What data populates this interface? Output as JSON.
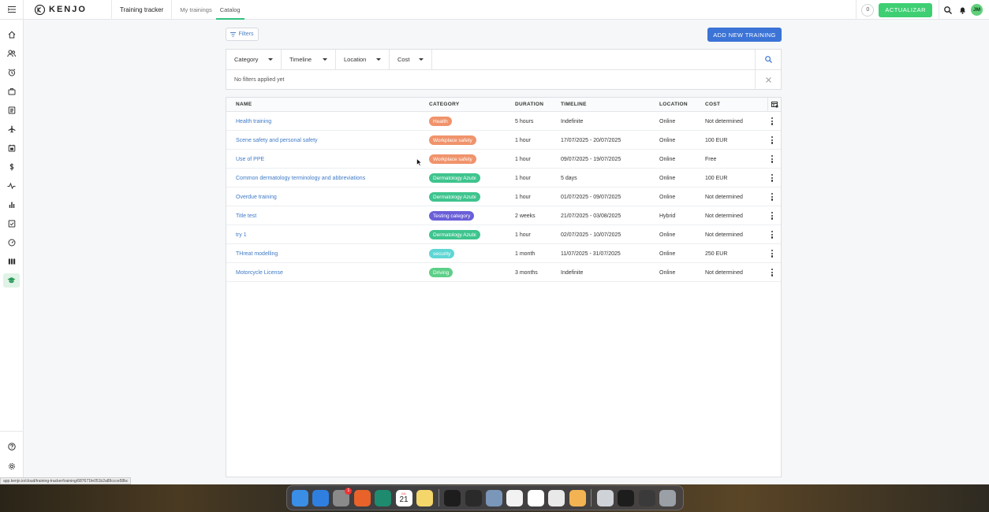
{
  "topbar": {
    "logo_text": "KENJO",
    "app_title": "Training tracker",
    "tabs": [
      {
        "label": "My trainings",
        "active": false
      },
      {
        "label": "Catalog",
        "active": true
      }
    ],
    "counter": "0",
    "update_label": "ACTUALIZAR",
    "avatar_initials": "JM"
  },
  "sidebar": {
    "items": [
      {
        "icon": "home-icon"
      },
      {
        "icon": "people-icon"
      },
      {
        "icon": "alarm-clock-icon"
      },
      {
        "icon": "briefcase-icon"
      },
      {
        "icon": "document-icon"
      },
      {
        "icon": "airplane-icon"
      },
      {
        "icon": "calendar-icon"
      },
      {
        "icon": "dollar-icon"
      },
      {
        "icon": "pulse-icon"
      },
      {
        "icon": "bar-chart-icon"
      },
      {
        "icon": "checklist-icon"
      },
      {
        "icon": "gauge-icon"
      },
      {
        "icon": "columns-icon"
      },
      {
        "icon": "graduation-cap-icon",
        "active": true
      }
    ],
    "bottom_items": [
      {
        "icon": "help-icon"
      },
      {
        "icon": "settings-icon"
      }
    ]
  },
  "toolbar": {
    "filters_label": "Filters",
    "add_label": "ADD NEW TRAINING"
  },
  "filters": {
    "selects": [
      "Category",
      "Timeline",
      "Location",
      "Cost"
    ],
    "no_filters_text": "No filters applied yet"
  },
  "table": {
    "headers": {
      "name": "NAME",
      "category": "CATEGORY",
      "duration": "DURATION",
      "timeline": "TIMELINE",
      "location": "LOCATION",
      "cost": "COST"
    },
    "rows": [
      {
        "name": "Health training",
        "category": "Health",
        "category_color": "#f0936b",
        "duration": "5 hours",
        "timeline": "Indefinite",
        "location": "Online",
        "cost": "Not determined"
      },
      {
        "name": "Scene safety and personal safety",
        "category": "Workplace safety",
        "category_color": "#f0936b",
        "duration": "1 hour",
        "timeline": "17/07/2025 - 20/07/2025",
        "location": "Online",
        "cost": "100 EUR"
      },
      {
        "name": "Use of PPE",
        "category": "Workplace safety",
        "category_color": "#f0936b",
        "duration": "1 hour",
        "timeline": "09/07/2025 - 19/07/2025",
        "location": "Online",
        "cost": "Free"
      },
      {
        "name": "Common dermatology terminology and abbreviations",
        "category": "Dermatology Azubi",
        "category_color": "#3fc48e",
        "duration": "1 hour",
        "timeline": "5 days",
        "location": "Online",
        "cost": "100 EUR"
      },
      {
        "name": "Overdue training",
        "category": "Dermatology Azubi",
        "category_color": "#3fc48e",
        "duration": "1 hour",
        "timeline": "01/07/2025 - 09/07/2025",
        "location": "Online",
        "cost": "Not determined"
      },
      {
        "name": "Title test",
        "category": "Testing category",
        "category_color": "#6a5fd8",
        "duration": "2 weeks",
        "timeline": "21/07/2025 - 03/08/2025",
        "location": "Hybrid",
        "cost": "Not determined"
      },
      {
        "name": "try 1",
        "category": "Dermatology Azubi",
        "category_color": "#3fc48e",
        "duration": "1 hour",
        "timeline": "02/07/2025 - 10/07/2025",
        "location": "Online",
        "cost": "Not determined"
      },
      {
        "name": "THreat modelling",
        "category": "security",
        "category_color": "#5fd6d4",
        "duration": "1 month",
        "timeline": "11/07/2025 - 31/07/2025",
        "location": "Online",
        "cost": "250 EUR"
      },
      {
        "name": "Motorcycle License",
        "category": "Driving",
        "category_color": "#5ccf88",
        "duration": "3 months",
        "timeline": "Indefinite",
        "location": "Online",
        "cost": "Not determined"
      }
    ]
  },
  "status_url": "app.kenjo.io/cloud/training-tracker/training/687671fe051b2a89ccce58bc",
  "dock": {
    "apps": [
      {
        "icon": "finder-icon",
        "color": "#3a8ee6"
      },
      {
        "icon": "safari-icon",
        "color": "#2f7fe0"
      },
      {
        "icon": "system-settings-icon",
        "color": "#8a8a8a",
        "badge": "1"
      },
      {
        "icon": "firefox-icon",
        "color": "#e8622a"
      },
      {
        "icon": "edge-icon",
        "color": "#1e8a6e"
      },
      {
        "icon": "calendar-app-icon",
        "color": "#ffffff",
        "text": "21",
        "month": "JUL"
      },
      {
        "icon": "notes-icon",
        "color": "#f5d66a"
      },
      {
        "icon": "terminal-icon",
        "color": "#1d1d1d"
      },
      {
        "icon": "cube-app-icon",
        "color": "#2a2a2a"
      },
      {
        "icon": "preview-icon",
        "color": "#7a96b8"
      },
      {
        "icon": "chrome-icon",
        "color": "#f2f2f2"
      },
      {
        "icon": "slack-icon",
        "color": "#ffffff"
      },
      {
        "icon": "textedit-icon",
        "color": "#e9e9e9"
      },
      {
        "icon": "dog-app-icon",
        "color": "#f4b352"
      }
    ],
    "recent": [
      {
        "icon": "screenshot-thumb-icon",
        "color": "#cfd3d8"
      },
      {
        "icon": "screenshot-thumb-icon-2",
        "color": "#1d1d1d"
      },
      {
        "icon": "screenshot-thumb-icon-3",
        "color": "#3a3a3a"
      },
      {
        "icon": "trash-icon",
        "color": "#9aa0a6"
      }
    ]
  }
}
